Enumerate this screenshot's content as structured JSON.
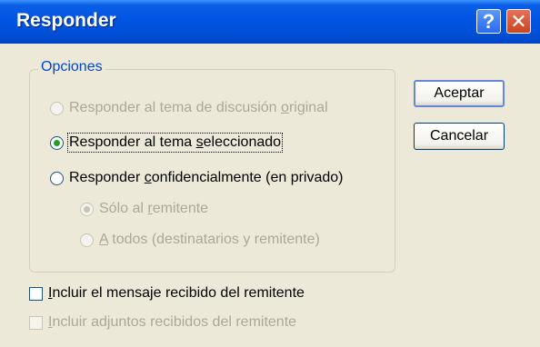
{
  "window": {
    "title": "Responder",
    "help_label": "?",
    "close_label": "✕"
  },
  "options": {
    "group_label": "Opciones",
    "radio_original": {
      "pre": "Responder al tema de discusión ",
      "key": "o",
      "post": "riginal",
      "checked": false,
      "enabled": false
    },
    "radio_selected": {
      "pre": "Responder al tema ",
      "key": "s",
      "post": "eleccionado",
      "checked": true,
      "enabled": true
    },
    "radio_private": {
      "pre": "Responder ",
      "key": "c",
      "post": "onfidencialmente (en privado)",
      "checked": false,
      "enabled": true
    },
    "sub_sender_only": {
      "pre": "Sólo al ",
      "key": "r",
      "post": "emitente",
      "checked": true,
      "enabled": false
    },
    "sub_all": {
      "pre": "",
      "key": "A",
      "post": " todos (destinatarios y remitente)",
      "checked": false,
      "enabled": false
    }
  },
  "checks": {
    "include_message": {
      "pre": "",
      "key": "I",
      "post": "ncluir el mensaje recibido del remitente",
      "checked": false,
      "enabled": true
    },
    "include_attachments": {
      "pre": "",
      "key": "I",
      "post": "ncluir adjuntos recibidos del remitente",
      "checked": false,
      "enabled": false
    }
  },
  "buttons": {
    "ok_label": "Aceptar",
    "cancel_label": "Cancelar"
  }
}
